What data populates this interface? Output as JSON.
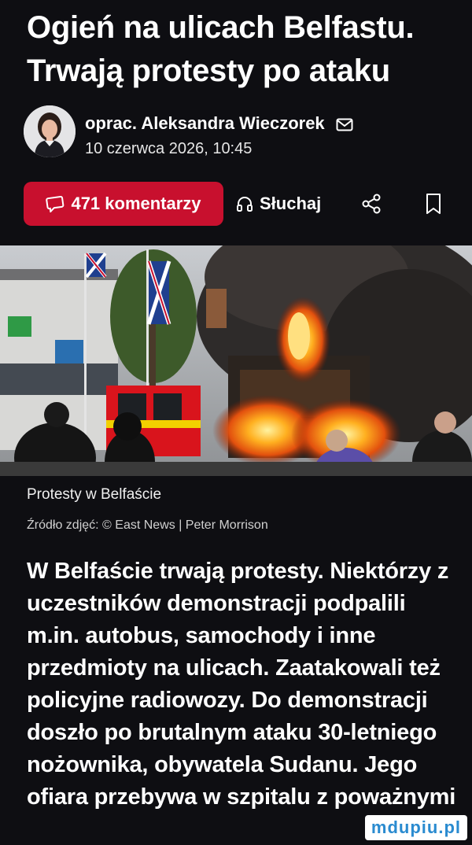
{
  "article": {
    "title_line1": "Ogień na ulicach Belfastu.",
    "title_line2": "Trwają protesty po ataku",
    "author": "oprac. Aleksandra Wieczorek",
    "date": "10 czerwca 2026, 10:45",
    "icons": {
      "mail": "mail-icon",
      "comment": "comment-icon",
      "headphones": "headphones-icon",
      "share": "share-icon",
      "bookmark": "bookmark-icon"
    }
  },
  "actions": {
    "comments_label": "471 komentarzy",
    "listen_label": "Słuchaj",
    "accent_color": "#c8102e"
  },
  "photo": {
    "caption": "Protesty w Belfaście",
    "credit": "Źródło zdjęć: © East News | Peter Morrison"
  },
  "body": {
    "lines": [
      "W Belfaście trwają protesty. Niektórzy z",
      "uczestników demonstracji podpalili",
      "m.in. autobus, samochody i inne",
      "przedmioty na ulicach. Zaatakowali też",
      "policyjne radiowozy. Do demonstracji",
      "doszło po brutalnym ataku 30-letniego",
      "nożownika, obywatela Sudanu. Jego",
      "ofiara przebywa w szpitalu z poważnymi"
    ]
  },
  "watermark": "mdupiu.pl"
}
